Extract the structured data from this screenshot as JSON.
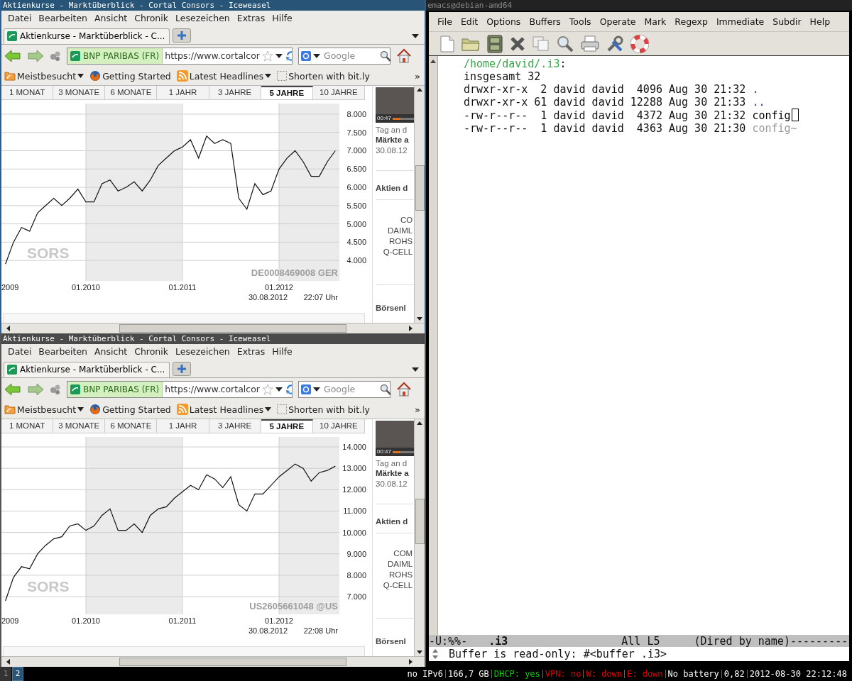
{
  "browser_windows": [
    {
      "title": "Aktienkurse - Marktüberblick - Cortal Consors - Iceweasel",
      "focused": true,
      "menu": [
        "Datei",
        "Bearbeiten",
        "Ansicht",
        "Chronik",
        "Lesezeichen",
        "Extras",
        "Hilfe"
      ],
      "tab": {
        "label": "Aktienkurse - Marktüberblick - C...",
        "selected": true
      },
      "identity": "BNP PARIBAS (FR)",
      "url": "https://www.cortalcor",
      "search": {
        "placeholder": "Google"
      },
      "bookmarks": [
        {
          "label": "Meistbesucht",
          "kind": "folder"
        },
        {
          "label": "Getting Started",
          "kind": "firefox"
        },
        {
          "label": "Latest Headlines",
          "kind": "feed"
        },
        {
          "label": "Shorten with bit.ly",
          "kind": "bookmarklet"
        }
      ],
      "bookmarks_overflow": "»",
      "ranges": [
        {
          "label": "1 MONAT",
          "selected": false
        },
        {
          "label": "3 MONATE",
          "selected": false
        },
        {
          "label": "6 MONATE",
          "selected": false
        },
        {
          "label": "1 JAHR",
          "selected": false
        },
        {
          "label": "3 JAHRE",
          "selected": false
        },
        {
          "label": "5 JAHRE",
          "selected": true
        },
        {
          "label": "10 JAHRE",
          "selected": false
        }
      ],
      "chart": {
        "logo_text": "SORS",
        "cut_x_label": "2009",
        "instrument": "DE0008469008  GER",
        "date": "30.08.2012",
        "time": "22:07 Uhr",
        "chart_data": {
          "type": "line",
          "grid": true,
          "ylim": [
            3440,
            8290
          ],
          "categories": [
            null,
            null,
            null,
            null,
            null,
            null,
            null,
            null,
            null,
            null,
            "01.2010",
            null,
            null,
            null,
            null,
            null,
            null,
            null,
            null,
            null,
            null,
            null,
            "01.2011",
            null,
            null,
            null,
            null,
            null,
            null,
            null,
            null,
            null,
            null,
            null,
            "01.2012",
            null,
            null,
            null,
            null,
            null,
            null,
            null
          ],
          "yticks": [
            {
              "value": 4000,
              "label": "4.000"
            },
            {
              "value": 4500,
              "label": "4.500"
            },
            {
              "value": 5000,
              "label": "5.000"
            },
            {
              "value": 5500,
              "label": "5.500"
            },
            {
              "value": 6000,
              "label": "6.000"
            },
            {
              "value": 6500,
              "label": "6.500"
            },
            {
              "value": 7000,
              "label": "7.000"
            },
            {
              "value": 7500,
              "label": "7.500"
            },
            {
              "value": 8000,
              "label": "8.000"
            }
          ],
          "values": [
            3900,
            4500,
            4900,
            4800,
            5300,
            5500,
            5700,
            5500,
            5700,
            5950,
            5600,
            5600,
            6100,
            6200,
            5900,
            6000,
            6150,
            5900,
            6200,
            6600,
            6800,
            7000,
            7100,
            7300,
            6800,
            7400,
            7200,
            7300,
            7200,
            5700,
            5400,
            6100,
            5800,
            5900,
            6500,
            6800,
            7000,
            6700,
            6300,
            6300,
            6700,
            7000
          ]
        }
      },
      "sidebar": {
        "video": {
          "time": "00:47",
          "level": 0.35
        },
        "teaser": "Tag an d",
        "headline": "Märkte a",
        "date": "30.08.12",
        "section": "Aktien d",
        "stocks": [
          "CO",
          "DAIML",
          "ROHS",
          "Q-CELL"
        ],
        "section_2": "Börsenl"
      }
    },
    {
      "title": "Aktienkurse - Marktüberblick - Cortal Consors - Iceweasel",
      "focused": false,
      "menu": [
        "Datei",
        "Bearbeiten",
        "Ansicht",
        "Chronik",
        "Lesezeichen",
        "Extras",
        "Hilfe"
      ],
      "tab": {
        "label": "Aktienkurse - Marktüberblick - C...",
        "selected": true
      },
      "identity": "BNP PARIBAS (FR)",
      "url": "https://www.cortalcor",
      "search": {
        "placeholder": "Google"
      },
      "bookmarks": [
        {
          "label": "Meistbesucht",
          "kind": "folder"
        },
        {
          "label": "Getting Started",
          "kind": "firefox"
        },
        {
          "label": "Latest Headlines",
          "kind": "feed"
        },
        {
          "label": "Shorten with bit.ly",
          "kind": "bookmarklet"
        }
      ],
      "bookmarks_overflow": "»",
      "ranges": [
        {
          "label": "1 MONAT",
          "selected": false
        },
        {
          "label": "3 MONATE",
          "selected": false
        },
        {
          "label": "6 MONATE",
          "selected": false
        },
        {
          "label": "1 JAHR",
          "selected": false
        },
        {
          "label": "3 JAHRE",
          "selected": false
        },
        {
          "label": "5 JAHRE",
          "selected": true
        },
        {
          "label": "10 JAHRE",
          "selected": false
        }
      ],
      "chart": {
        "logo_text": "SORS",
        "cut_x_label": "2009",
        "instrument": "US2605661048  @US",
        "date": "30.08.2012",
        "time": "22:08 Uhr",
        "chart_data": {
          "type": "line",
          "grid": true,
          "ylim": [
            6170,
            14465
          ],
          "categories": [
            null,
            null,
            null,
            null,
            null,
            null,
            null,
            null,
            null,
            null,
            "01.2010",
            null,
            null,
            null,
            null,
            null,
            null,
            null,
            null,
            null,
            null,
            null,
            "01.2011",
            null,
            null,
            null,
            null,
            null,
            null,
            null,
            null,
            null,
            null,
            null,
            "01.2012",
            null,
            null,
            null,
            null,
            null,
            null,
            null
          ],
          "yticks": [
            {
              "value": 7000,
              "label": "7.000"
            },
            {
              "value": 8000,
              "label": "8.000"
            },
            {
              "value": 9000,
              "label": "9.000"
            },
            {
              "value": 10000,
              "label": "10.000"
            },
            {
              "value": 11000,
              "label": "11.000"
            },
            {
              "value": 12000,
              "label": "12.000"
            },
            {
              "value": 13000,
              "label": "13.000"
            },
            {
              "value": 14000,
              "label": "14.000"
            }
          ],
          "values": [
            6800,
            7900,
            8400,
            8300,
            9000,
            9400,
            9700,
            9800,
            10300,
            10400,
            10100,
            10300,
            10800,
            11100,
            10100,
            10100,
            10400,
            10000,
            10800,
            11100,
            11200,
            11600,
            11900,
            12200,
            12000,
            12700,
            12500,
            12100,
            12600,
            11300,
            11000,
            11800,
            11800,
            12200,
            12600,
            12900,
            13200,
            13000,
            12400,
            12800,
            12900,
            13100
          ]
        }
      },
      "sidebar": {
        "video": {
          "time": "00:47",
          "level": 0.35
        },
        "teaser": "Tag an d",
        "headline": "Märkte a",
        "date": "30.08.12",
        "section": "Aktien d",
        "stocks": [
          "COM",
          "DAIML",
          "ROHS",
          "Q-CELL"
        ],
        "section_2": "Börsenl"
      }
    }
  ],
  "emacs": {
    "title": "emacs@debian-amd64",
    "focused": false,
    "menu": [
      "File",
      "Edit",
      "Options",
      "Buffers",
      "Tools",
      "Operate",
      "Mark",
      "Regexp",
      "Immediate",
      "Subdir",
      "Help"
    ],
    "buffer": {
      "path": "/home/david/.i3",
      "path_suffix": ":",
      "summary": "insgesamt 32",
      "entries": [
        {
          "info": "drwxr-xr-x  2 david david  4096 Aug 30 21:32",
          "name": ".",
          "kind": "dir",
          "cursor": false
        },
        {
          "info": "drwxr-xr-x 61 david david 12288 Aug 30 21:33",
          "name": "..",
          "kind": "dir",
          "cursor": false
        },
        {
          "info": "-rw-r--r--  1 david david  4372 Aug 30 21:32",
          "name": "config",
          "kind": "file",
          "cursor": true
        },
        {
          "info": "-rw-r--r--  1 david david  4363 Aug 30 21:30",
          "name": "config~",
          "kind": "backup",
          "cursor": false
        }
      ]
    },
    "mode_line": {
      "status": "-U:%%-",
      "buffer": ".i3",
      "position": "All L5",
      "mode": "(Dired by name)",
      "fill": "---------"
    },
    "echo": "Buffer is read-only: #<buffer .i3>"
  },
  "status_bar": {
    "workspaces": [
      {
        "label": "1",
        "selected": false
      },
      {
        "label": "2",
        "selected": true
      }
    ],
    "segments": [
      {
        "text": "no IPv6",
        "color": "#ffffff"
      },
      {
        "text": "166,7 GB",
        "color": "#ffffff"
      },
      {
        "text": "DHCP: yes",
        "color": "#00cc00"
      },
      {
        "text": "VPN: no",
        "color": "#dd0000"
      },
      {
        "text": "W: down",
        "color": "#dd0000"
      },
      {
        "text": "E: down",
        "color": "#dd0000"
      },
      {
        "text": "No battery",
        "color": "#ffffff"
      },
      {
        "text": "0,82",
        "color": "#ffffff"
      },
      {
        "text": "2012-08-30 22:12:48",
        "color": "#ffffff"
      }
    ]
  }
}
